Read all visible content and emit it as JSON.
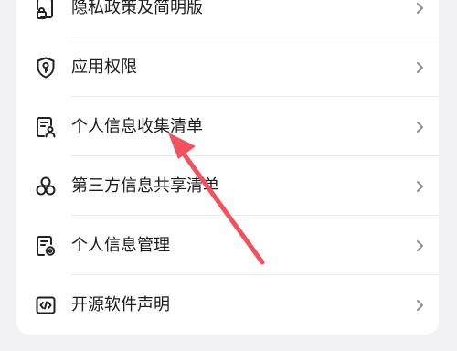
{
  "menu": {
    "items": [
      {
        "label": "隐私政策及简明版",
        "icon": "privacy-lock-document-icon"
      },
      {
        "label": "应用权限",
        "icon": "shield-key-icon"
      },
      {
        "label": "个人信息收集清单",
        "icon": "document-person-icon"
      },
      {
        "label": "第三方信息共享清单",
        "icon": "three-circles-share-icon"
      },
      {
        "label": "个人信息管理",
        "icon": "document-settings-icon"
      },
      {
        "label": "开源软件声明",
        "icon": "code-window-icon"
      }
    ]
  },
  "colors": {
    "page_bg": "#f2f2f4",
    "card_bg": "#ffffff",
    "text": "#1c1c1c",
    "icon_stroke": "#222222",
    "chevron": "#8e8e93",
    "annotation_arrow": "#f0525f"
  }
}
